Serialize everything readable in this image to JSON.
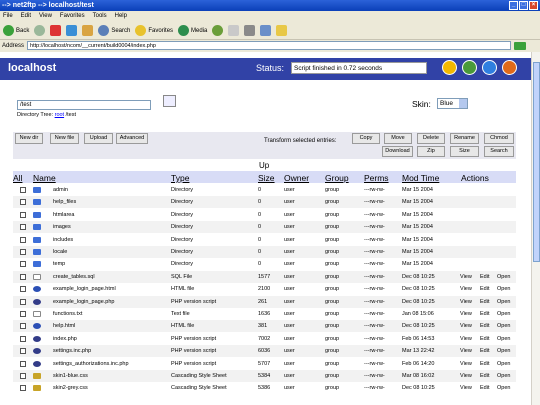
{
  "window": {
    "title": "--> net2ftp --> localhost/test",
    "menu": [
      "File",
      "Edit",
      "View",
      "Favorites",
      "Tools",
      "Help"
    ],
    "toolbar": {
      "back": "Back",
      "search": "Search",
      "favorites": "Favorites",
      "media": "Media"
    },
    "address_label": "Address",
    "address": "http://localhost/ncom/__current/build0004/index.php"
  },
  "header": {
    "brand": "localhost",
    "status_label": "Status:",
    "status_value": "Script finished in 0.72 seconds",
    "icons": [
      {
        "name": "bookmark-star-icon",
        "color": "#f2b800"
      },
      {
        "name": "refresh-icon",
        "color": "#4a9a3a"
      },
      {
        "name": "help-icon",
        "color": "#2f7fe0"
      },
      {
        "name": "logout-icon",
        "color": "#e06a1a"
      }
    ]
  },
  "directory": {
    "value": "/test",
    "tree_label": "Directory Tree:",
    "tree_root": "root",
    "tree_path": "/test"
  },
  "skin": {
    "label": "Skin:",
    "value": "Blue"
  },
  "actions": {
    "left": [
      "New dir",
      "New file",
      "Upload",
      "Advanced"
    ],
    "transform_label": "Transform selected entries:",
    "right_row1": [
      "Copy",
      "Move",
      "Delete",
      "Rename",
      "Chmod"
    ],
    "right_row2": [
      "Download",
      "Zip",
      "Size",
      "Search"
    ]
  },
  "table": {
    "up": "Up",
    "headers": {
      "all": "All",
      "name": "Name",
      "type": "Type",
      "size": "Size",
      "owner": "Owner",
      "group": "Group",
      "perms": "Perms",
      "mod": "Mod Time",
      "actions": "Actions"
    },
    "rows": [
      {
        "icon": "dir",
        "name": "admin",
        "type": "Directory",
        "size": "0",
        "owner": "user",
        "group": "group",
        "perms": "---rw-rw-",
        "mod": "Mar 15 2004",
        "links": []
      },
      {
        "icon": "dir",
        "name": "help_files",
        "type": "Directory",
        "size": "0",
        "owner": "user",
        "group": "group",
        "perms": "---rw-rw-",
        "mod": "Mar 15 2004",
        "links": []
      },
      {
        "icon": "dir",
        "name": "htmlarea",
        "type": "Directory",
        "size": "0",
        "owner": "user",
        "group": "group",
        "perms": "---rw-rw-",
        "mod": "Mar 15 2004",
        "links": []
      },
      {
        "icon": "dir",
        "name": "images",
        "type": "Directory",
        "size": "0",
        "owner": "user",
        "group": "group",
        "perms": "---rw-rw-",
        "mod": "Mar 15 2004",
        "links": []
      },
      {
        "icon": "dir",
        "name": "includes",
        "type": "Directory",
        "size": "0",
        "owner": "user",
        "group": "group",
        "perms": "---rw-rw-",
        "mod": "Mar 15 2004",
        "links": []
      },
      {
        "icon": "dir",
        "name": "locale",
        "type": "Directory",
        "size": "0",
        "owner": "user",
        "group": "group",
        "perms": "---rw-rw-",
        "mod": "Mar 15 2004",
        "links": []
      },
      {
        "icon": "dir",
        "name": "temp",
        "type": "Directory",
        "size": "0",
        "owner": "user",
        "group": "group",
        "perms": "---rw-rw-",
        "mod": "Mar 15 2004",
        "links": []
      },
      {
        "icon": "sql",
        "name": "create_tables.sql",
        "type": "SQL File",
        "size": "1577",
        "owner": "user",
        "group": "group",
        "perms": "---rw-rw-",
        "mod": "Dec 08 10:25",
        "links": [
          "View",
          "Edit",
          "Open"
        ]
      },
      {
        "icon": "html",
        "name": "example_login_page.html",
        "type": "HTML file",
        "size": "2100",
        "owner": "user",
        "group": "group",
        "perms": "---rw-rw-",
        "mod": "Dec 08 10:25",
        "links": [
          "View",
          "Edit",
          "Open"
        ]
      },
      {
        "icon": "php",
        "name": "example_login_page.php",
        "type": "PHP version script",
        "size": "261",
        "owner": "user",
        "group": "group",
        "perms": "---rw-rw-",
        "mod": "Dec 08 10:25",
        "links": [
          "View",
          "Edit",
          "Open"
        ]
      },
      {
        "icon": "txt",
        "name": "functions.txt",
        "type": "Text file",
        "size": "1636",
        "owner": "user",
        "group": "group",
        "perms": "---rw-rw-",
        "mod": "Jan 08 15:06",
        "links": [
          "View",
          "Edit",
          "Open"
        ]
      },
      {
        "icon": "html",
        "name": "help.html",
        "type": "HTML file",
        "size": "381",
        "owner": "user",
        "group": "group",
        "perms": "---rw-rw-",
        "mod": "Dec 08 10:25",
        "links": [
          "View",
          "Edit",
          "Open"
        ]
      },
      {
        "icon": "php",
        "name": "index.php",
        "type": "PHP version script",
        "size": "7002",
        "owner": "user",
        "group": "group",
        "perms": "---rw-rw-",
        "mod": "Feb 06 14:53",
        "links": [
          "View",
          "Edit",
          "Open"
        ]
      },
      {
        "icon": "php",
        "name": "settings.inc.php",
        "type": "PHP version script",
        "size": "6036",
        "owner": "user",
        "group": "group",
        "perms": "---rw-rw-",
        "mod": "Mar 13 22:42",
        "links": [
          "View",
          "Edit",
          "Open"
        ]
      },
      {
        "icon": "php",
        "name": "settings_authorizations.inc.php",
        "type": "PHP version script",
        "size": "5707",
        "owner": "user",
        "group": "group",
        "perms": "---rw-rw-",
        "mod": "Feb 06 14:20",
        "links": [
          "View",
          "Edit",
          "Open"
        ]
      },
      {
        "icon": "css",
        "name": "skin1-blue.css",
        "type": "Cascading Style Sheet",
        "size": "5384",
        "owner": "user",
        "group": "group",
        "perms": "---rw-rw-",
        "mod": "Mar 08 16:02",
        "links": [
          "View",
          "Edit",
          "Open"
        ]
      },
      {
        "icon": "css",
        "name": "skin2-grey.css",
        "type": "Cascading Style Sheet",
        "size": "5386",
        "owner": "user",
        "group": "group",
        "perms": "---rw-rw-",
        "mod": "Dec 08 10:25",
        "links": [
          "View",
          "Edit",
          "Open"
        ]
      }
    ]
  }
}
